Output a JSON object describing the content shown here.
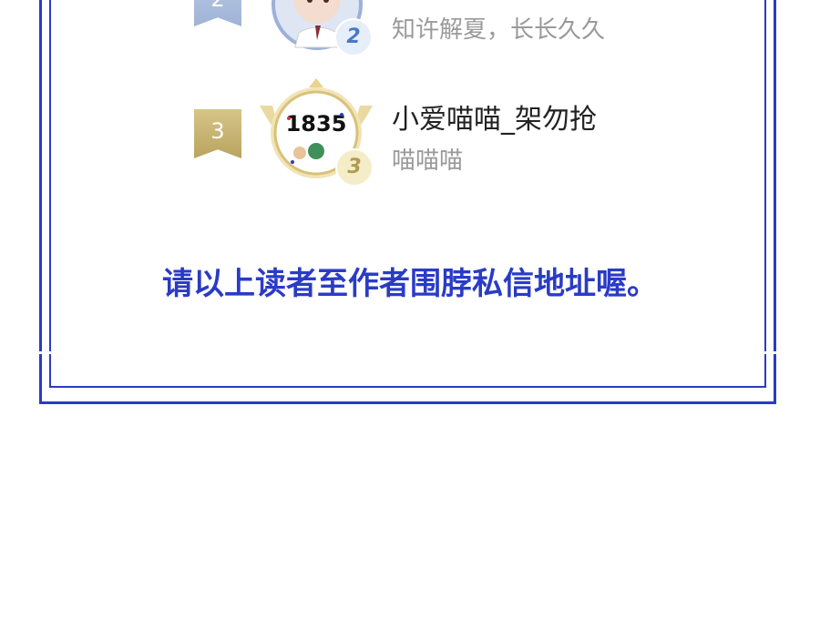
{
  "ranking": [
    {
      "rank": "2",
      "name": "",
      "message": "知许解夏，长长久久",
      "medal": "2",
      "ribbon_color": "#a9bddd",
      "medal_color": "#4b78c4"
    },
    {
      "rank": "3",
      "name": "小爱喵喵_架勿抢",
      "message": "喵喵喵",
      "medal": "3",
      "ribbon_color": "#c8b675",
      "medal_color": "#b19b4e",
      "avatar_text": "1835"
    }
  ],
  "notice": "请以上读者至作者围脖私信地址喔。",
  "colors": {
    "frame": "#2a3bc6",
    "name": "#222222",
    "message": "#9a9a9a"
  }
}
